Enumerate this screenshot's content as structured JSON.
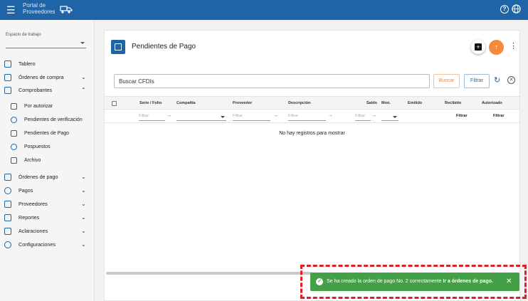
{
  "topbar": {
    "menu_icon": "menu-icon",
    "logo_text": "Portal de Proveedores",
    "help_icon": "?",
    "lang_icon": "globe-icon"
  },
  "workspace": {
    "label": "Espacio de trabajo",
    "value": ""
  },
  "sidebar": {
    "items": [
      {
        "label": "Tablero",
        "icon": "dashboard-icon"
      },
      {
        "label": "Órdenes de compra",
        "icon": "orders-icon",
        "chevron": "⌄"
      },
      {
        "label": "Comprobantes",
        "icon": "document-icon",
        "chevron": "⌃"
      },
      {
        "label": "Órdenes de pago",
        "icon": "payment-card-icon",
        "chevron": "⌄"
      },
      {
        "label": "Pagos",
        "icon": "money-icon",
        "chevron": "⌄"
      },
      {
        "label": "Proveedores",
        "icon": "building-icon",
        "chevron": "⌄"
      },
      {
        "label": "Reportes",
        "icon": "chart-icon",
        "chevron": "⌄"
      },
      {
        "label": "Aclaraciones",
        "icon": "mail-icon",
        "chevron": "⌄"
      },
      {
        "label": "Configuraciones",
        "icon": "gear-icon",
        "chevron": "⌄"
      }
    ],
    "subitems": [
      {
        "label": "Por autorizar",
        "icon": "gavel-icon"
      },
      {
        "label": "Pendientes de verificación",
        "icon": "shield-check-icon"
      },
      {
        "label": "Pendientes de Pago",
        "icon": "pending-payment-icon"
      },
      {
        "label": "Pospuestos",
        "icon": "clock-icon"
      },
      {
        "label": "Archivo",
        "icon": "archive-icon"
      }
    ]
  },
  "main": {
    "title": "Pendientes de Pago",
    "search": {
      "value": "Buscar CFDIs"
    },
    "buscar_label": "Buscar",
    "filtrar_label": "Filtrar",
    "columns": [
      "Serie / Folio",
      "Compañía",
      "Proveedor",
      "Descripción",
      "Saldo",
      "Mon.",
      "Emitido",
      "Recibido",
      "Autorizado"
    ],
    "filter_placeholder": "Filtrar",
    "filter_link": "Filtrar",
    "empty_text": "No hay registros para mostrar"
  },
  "toast": {
    "message": "Se ha creado la orden de pago No. 2 correctamente ",
    "link": "Ir a órdenes de pago.",
    "close": "✕"
  }
}
